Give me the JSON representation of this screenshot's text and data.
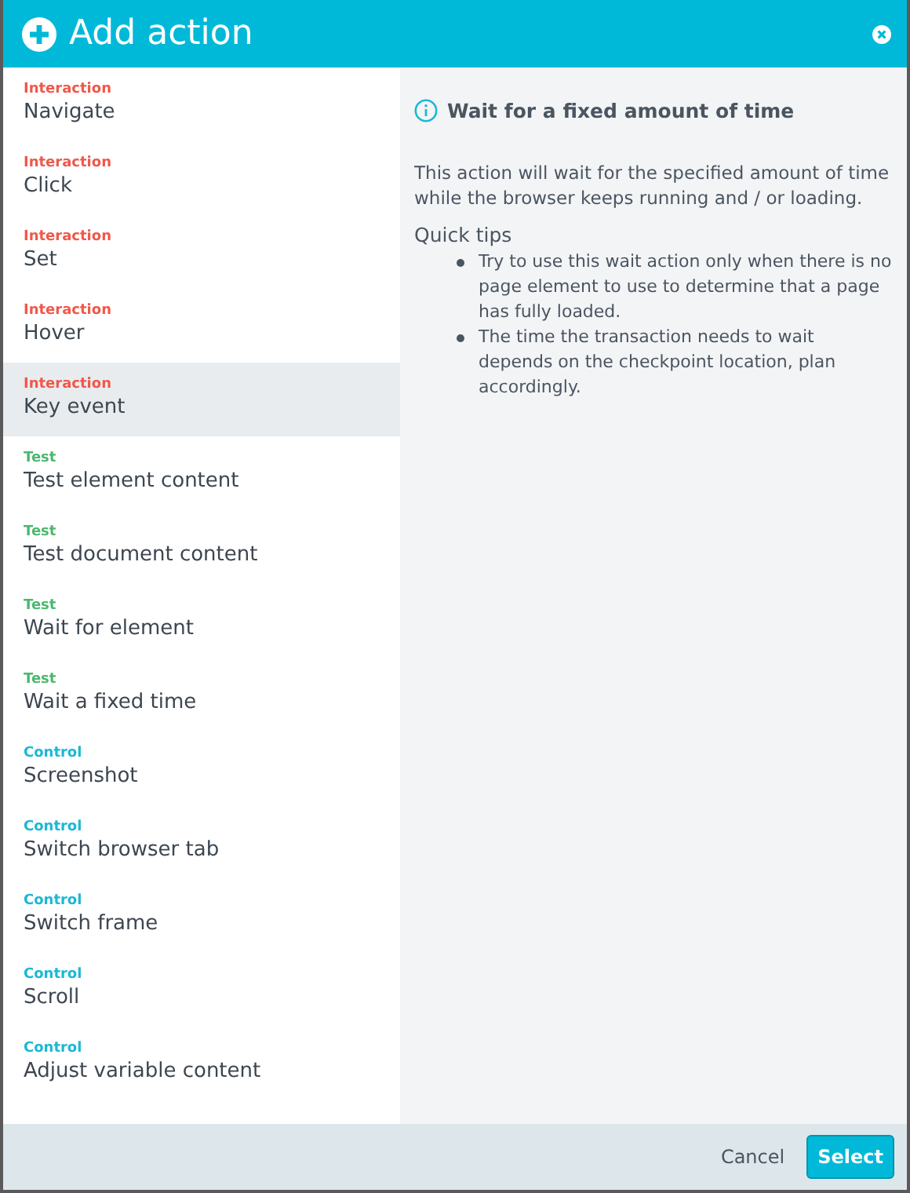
{
  "window": {
    "title": "Add action"
  },
  "actions": [
    {
      "category": "Interaction",
      "name": "Navigate",
      "color": "#f0584a",
      "selected": false
    },
    {
      "category": "Interaction",
      "name": "Click",
      "color": "#f0584a",
      "selected": false
    },
    {
      "category": "Interaction",
      "name": "Set",
      "color": "#f0584a",
      "selected": false
    },
    {
      "category": "Interaction",
      "name": "Hover",
      "color": "#f0584a",
      "selected": false
    },
    {
      "category": "Interaction",
      "name": "Key event",
      "color": "#f0584a",
      "selected": true
    },
    {
      "category": "Test",
      "name": "Test element content",
      "color": "#4cb86e",
      "selected": false
    },
    {
      "category": "Test",
      "name": "Test document content",
      "color": "#4cb86e",
      "selected": false
    },
    {
      "category": "Test",
      "name": "Wait for element",
      "color": "#4cb86e",
      "selected": false
    },
    {
      "category": "Test",
      "name": "Wait a fixed time",
      "color": "#4cb86e",
      "selected": false
    },
    {
      "category": "Control",
      "name": "Screenshot",
      "color": "#1bb8d6",
      "selected": false
    },
    {
      "category": "Control",
      "name": "Switch browser tab",
      "color": "#1bb8d6",
      "selected": false
    },
    {
      "category": "Control",
      "name": "Switch frame",
      "color": "#1bb8d6",
      "selected": false
    },
    {
      "category": "Control",
      "name": "Scroll",
      "color": "#1bb8d6",
      "selected": false
    },
    {
      "category": "Control",
      "name": "Adjust variable content",
      "color": "#1bb8d6",
      "selected": false
    }
  ],
  "detail": {
    "title": "Wait for a fixed amount of time",
    "description": "This action will wait for the specified amount of time while the browser keeps running and / or loading.",
    "tips_heading": "Quick tips",
    "tips": [
      "Try to use this wait action only when there is no page element to use to determine that a page has fully loaded.",
      "The time the transaction needs to wait depends on the checkpoint location, plan accordingly."
    ]
  },
  "buttons": {
    "cancel": "Cancel",
    "select": "Select"
  }
}
